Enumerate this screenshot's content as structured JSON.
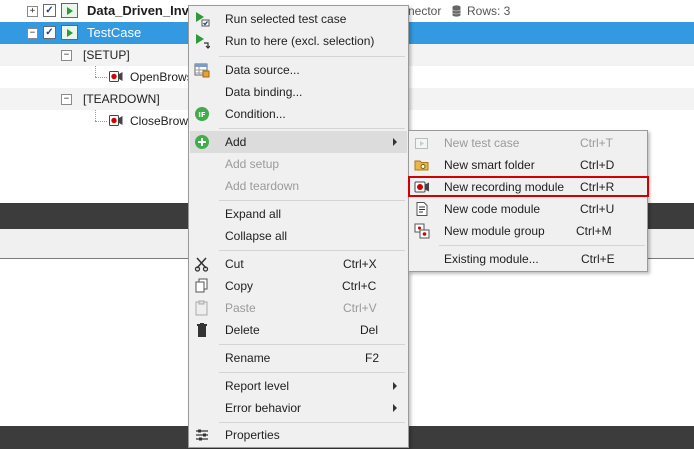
{
  "tree": {
    "row1": {
      "label": "Data_Driven_Inval",
      "connector_label": "nector",
      "rows_label": "Rows: 3"
    },
    "row2": {
      "label": "TestCase"
    },
    "row3": {
      "label": "[SETUP]"
    },
    "row4": {
      "label": "OpenBrows"
    },
    "row5": {
      "label": "[TEARDOWN]"
    },
    "row6": {
      "label": "CloseBrows"
    }
  },
  "context_menu": {
    "items": [
      {
        "label": "Run selected test case",
        "icon": "run-selected-icon"
      },
      {
        "label": "Run to here (excl. selection)",
        "icon": "run-to-here-icon"
      },
      {
        "label": "Data source...",
        "icon": "data-source-icon"
      },
      {
        "label": "Data binding...",
        "icon": ""
      },
      {
        "label": "Condition...",
        "icon": "condition-icon"
      },
      {
        "label": "Add",
        "icon": "add-icon"
      },
      {
        "label": "Add setup",
        "icon": ""
      },
      {
        "label": "Add teardown",
        "icon": ""
      },
      {
        "label": "Expand all",
        "icon": ""
      },
      {
        "label": "Collapse all",
        "icon": ""
      },
      {
        "label": "Cut",
        "shortcut": "Ctrl+X",
        "icon": "scissors-icon"
      },
      {
        "label": "Copy",
        "shortcut": "Ctrl+C",
        "icon": "copy-icon"
      },
      {
        "label": "Paste",
        "shortcut": "Ctrl+V",
        "icon": "paste-icon"
      },
      {
        "label": "Delete",
        "shortcut": "Del",
        "icon": "trash-icon"
      },
      {
        "label": "Rename",
        "shortcut": "F2",
        "icon": ""
      },
      {
        "label": "Report level",
        "icon": ""
      },
      {
        "label": "Error behavior",
        "icon": ""
      },
      {
        "label": "Properties",
        "icon": "properties-icon"
      }
    ]
  },
  "submenu": {
    "items": [
      {
        "label": "New test case",
        "shortcut": "Ctrl+T",
        "icon": "new-test-case-icon"
      },
      {
        "label": "New smart folder",
        "shortcut": "Ctrl+D",
        "icon": "folder-icon"
      },
      {
        "label": "New recording module",
        "shortcut": "Ctrl+R",
        "icon": "recording-icon"
      },
      {
        "label": "New code module",
        "shortcut": "Ctrl+U",
        "icon": "code-module-icon"
      },
      {
        "label": "New module group",
        "shortcut": "Ctrl+M",
        "icon": "module-group-icon"
      },
      {
        "label": "Existing module...",
        "shortcut": "Ctrl+E",
        "icon": ""
      }
    ]
  },
  "colors": {
    "selection": "#3399e0",
    "highlight_border": "#d40000",
    "dark_bar": "#3c3c3c",
    "menu_bg": "#f0f0f0"
  }
}
